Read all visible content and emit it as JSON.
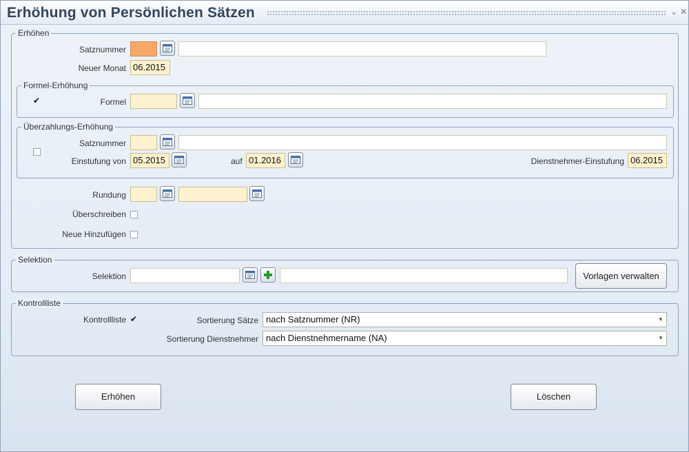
{
  "window": {
    "title": "Erhöhung von Persönlichen Sätzen",
    "minimize_glyph": "⌄",
    "close_glyph": "✕"
  },
  "erhoehen": {
    "legend": "Erhöhen",
    "satznummer_label": "Satznummer",
    "satznummer_value": "",
    "satznummer_desc": "",
    "neuer_monat_label": "Neuer Monat",
    "neuer_monat_value": "06.2015"
  },
  "formel": {
    "legend": "Formel-Erhöhung",
    "checked": true,
    "label": "Formel",
    "value": "",
    "desc": ""
  },
  "ueberzahlung": {
    "legend": "Überzahlungs-Erhöhung",
    "checked": false,
    "satznummer_label": "Satznummer",
    "satznummer_value": "",
    "satznummer_desc": "",
    "einstufung_von_label": "Einstufung von",
    "einstufung_von_value": "05.2015",
    "auf_label": "auf",
    "auf_value": "01.2016",
    "dn_einstufung_label": "Dienstnehmer-Einstufung",
    "dn_einstufung_value": "06.2015"
  },
  "rundung": {
    "label": "Rundung",
    "value": "",
    "desc": "",
    "ueberschreiben_label": "Überschreiben",
    "ueberschreiben_checked": false,
    "neue_label": "Neue Hinzufügen",
    "neue_checked": false
  },
  "selektion": {
    "legend": "Selektion",
    "label": "Selektion",
    "value": "",
    "desc": "",
    "vorlagen_button": "Vorlagen verwalten"
  },
  "kontrollliste": {
    "legend": "Kontrollliste",
    "label": "Kontrollliste",
    "checked": true,
    "sortierung_saetze_label": "Sortierung Sätze",
    "sortierung_saetze_value": "nach Satznummer (NR)",
    "sortierung_dn_label": "Sortierung Dienstnehmer",
    "sortierung_dn_value": "nach Dienstnehmername (NA)"
  },
  "actions": {
    "erhoehen_button": "Erhöhen",
    "loeschen_button": "Löschen"
  },
  "colors": {
    "selected_field": "#f6a868",
    "required_field": "#fdf2cf",
    "title_text": "#33465c",
    "group_border": "#8ea3bc"
  },
  "icons": {
    "lookup": "list-lookup-icon",
    "add": "green-plus-icon"
  }
}
